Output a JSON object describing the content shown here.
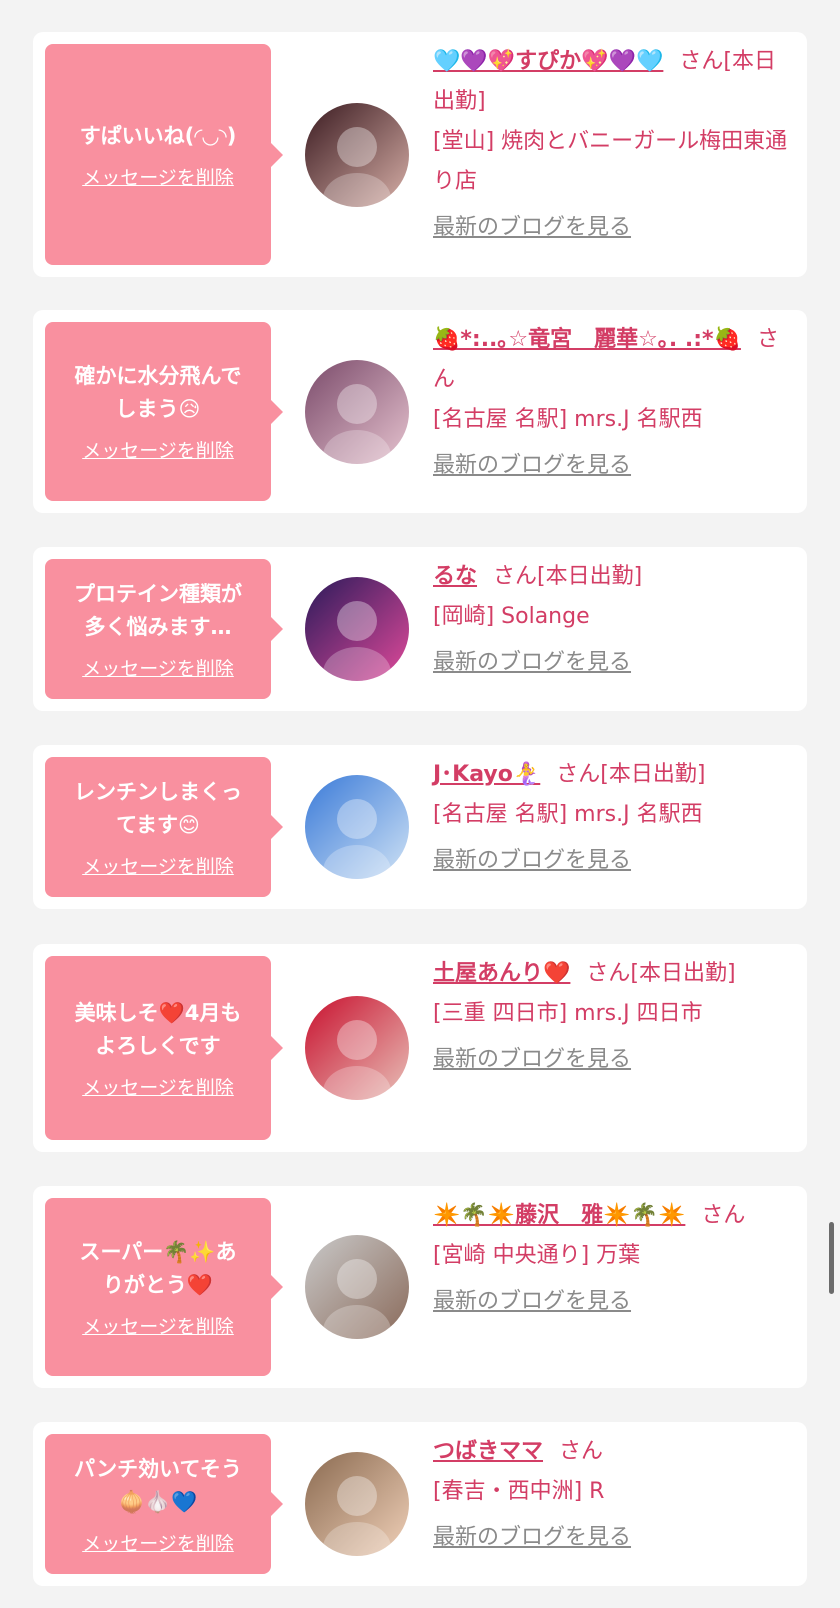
{
  "delete_label": "メッセージを削除",
  "blog_label": "最新のブログを見る",
  "colors": {
    "accent": "#d33d65",
    "bubble": "#f9909f",
    "background": "#f3f3f3"
  },
  "entries": [
    {
      "message": "すぱいいね(◜◡◝)",
      "name": "🩵💜💖すぴか💖💜🩵",
      "suffix": "さん[本日出勤]",
      "shop": "[堂山] 焼肉とバニーガール梅田東通り店",
      "avatar_icon": "avatar-photo"
    },
    {
      "message": "確かに水分飛んで\nしまう😥",
      "name": "🍓*:..｡☆竜宮　麗華☆｡. .:*🍓",
      "suffix": "さん",
      "shop": "[名古屋 名駅] mrs.J 名駅西",
      "avatar_icon": "avatar-photo"
    },
    {
      "message": "プロテイン種類が\n多く悩みます…",
      "name": "るな",
      "suffix": "さん[本日出勤]",
      "shop": "[岡崎] Solange",
      "avatar_icon": "avatar-photo"
    },
    {
      "message": "レンチンしまくっ\nてます😊",
      "name": "J･Kayo🧜‍♀️",
      "suffix": "さん[本日出勤]",
      "shop": "[名古屋 名駅] mrs.J 名駅西",
      "avatar_icon": "avatar-photo"
    },
    {
      "message": "美味しそ❤️4月も\nよろしくです",
      "name": "土屋あんり❤️",
      "suffix": "さん[本日出勤]",
      "shop": "[三重 四日市] mrs.J 四日市",
      "avatar_icon": "avatar-photo"
    },
    {
      "message": "スーパー🌴✨あ\nりがとう❤️",
      "name": "✴️🌴✴️藤沢　雅✴️🌴✴️",
      "suffix": "さん",
      "shop": "[宮崎 中央通り] 万葉",
      "avatar_icon": "avatar-photo"
    },
    {
      "message": "パンチ効いてそう\n🧅🧄💙",
      "name": "つばきママ",
      "suffix": "さん",
      "shop": "[春吉・西中洲] R",
      "avatar_icon": "avatar-photo"
    }
  ]
}
